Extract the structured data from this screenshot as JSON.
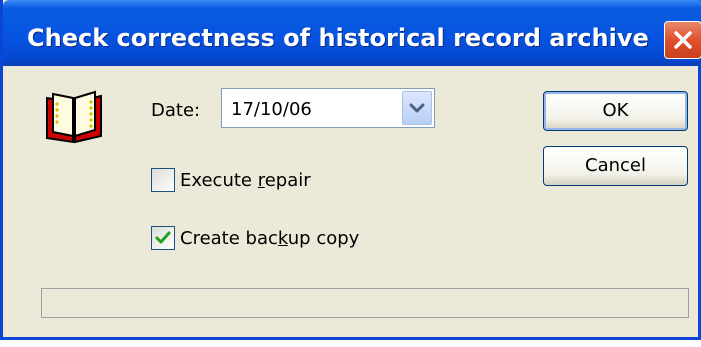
{
  "window": {
    "title": "Check correctness of historical record archive",
    "accent": "#0654e1",
    "close_icon": "close-icon"
  },
  "form": {
    "date_label": "Date:",
    "date_value": "17/10/06",
    "icon": "open-book-icon"
  },
  "options": {
    "execute_repair": {
      "pre": "Execute ",
      "key": "r",
      "post": "epair",
      "checked": false
    },
    "create_backup": {
      "pre": "Create bac",
      "key": "k",
      "post": "up copy",
      "checked": true
    }
  },
  "buttons": {
    "ok_label": "OK",
    "cancel_label": "Cancel"
  },
  "status": {
    "text": ""
  }
}
